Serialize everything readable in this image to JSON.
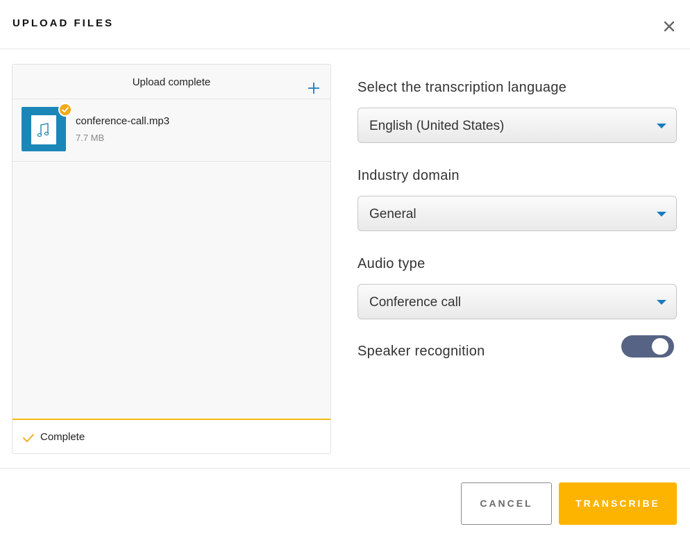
{
  "dialog": {
    "title": "UPLOAD FILES",
    "close_icon": "close-icon"
  },
  "upload_panel": {
    "header": "Upload complete",
    "add_icon": "plus-icon",
    "files": [
      {
        "name": "conference-call.mp3",
        "size": "7.7 MB",
        "icon": "music-note-icon",
        "status_icon": "check-badge-icon"
      }
    ],
    "footer_status": "Complete",
    "footer_icon": "check-icon"
  },
  "form": {
    "language": {
      "label": "Select the transcription language",
      "value": "English (United States)"
    },
    "domain": {
      "label": "Industry domain",
      "value": "General"
    },
    "audio_type": {
      "label": "Audio type",
      "value": "Conference call"
    },
    "speaker_recognition": {
      "label": "Speaker recognition",
      "enabled": true
    }
  },
  "actions": {
    "cancel": "CANCEL",
    "transcribe": "TRANSCRIBE"
  },
  "colors": {
    "accent": "#fdb400",
    "file_thumb": "#1b87b8",
    "toggle_on": "#566384",
    "caret": "#1a7cc1"
  }
}
